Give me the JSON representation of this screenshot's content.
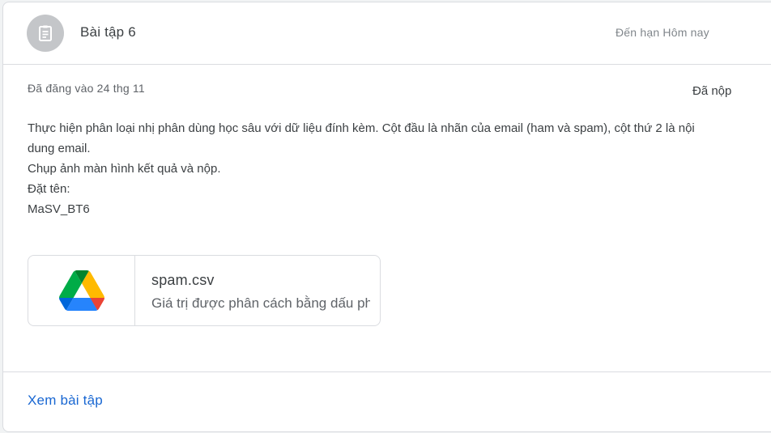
{
  "assignment": {
    "title": "Bài tập 6",
    "due": "Đến hạn Hôm nay",
    "posted": "Đã đăng vào 24 thg 11",
    "status": "Đã nộp",
    "description": [
      "Thực hiện phân loại nhị phân dùng học sâu với dữ liệu đính kèm. Cột đầu là nhãn của email (ham và spam), cột thứ 2 là nội",
      "dung email.",
      "Chụp ảnh màn hình kết quả và nộp.",
      "",
      "Đặt tên:",
      "MaSV_BT6"
    ]
  },
  "attachment": {
    "icon": "google-drive-icon",
    "name": "spam.csv",
    "type": "Giá trị được phân cách bằng dấu phẩy"
  },
  "footer": {
    "view_label": "Xem bài tập"
  },
  "colors": {
    "link": "#1967d2",
    "avatar_bg": "#c4c6c9",
    "text": "#3c4043",
    "muted": "#5f6368"
  }
}
